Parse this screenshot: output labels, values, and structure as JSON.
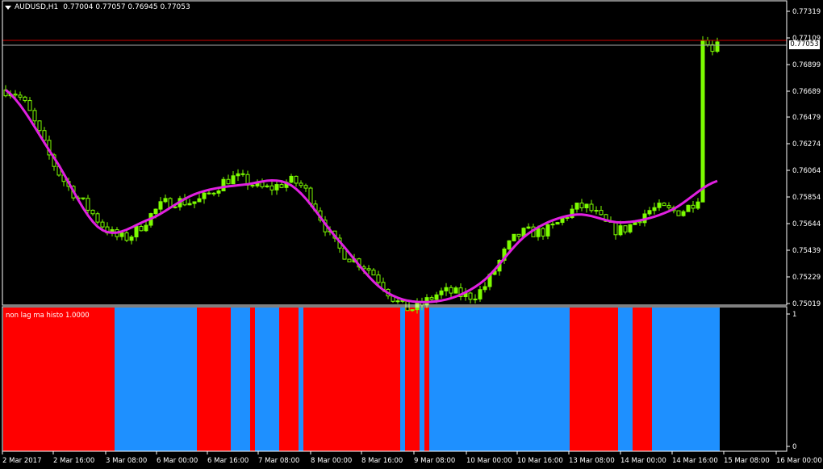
{
  "window": {
    "symbol_label": "AUDUSD,H1",
    "ohlc_label": "0.77004 0.77057 0.76945 0.77053"
  },
  "indicator": {
    "title": "non lag ma histo 1.0000",
    "axis_labels": [
      "1",
      "0"
    ]
  },
  "price_axis": {
    "ticks": [
      "0.77319",
      "0.77109",
      "0.76899",
      "0.76689",
      "0.76479",
      "0.76274",
      "0.76064",
      "0.75854",
      "0.75644",
      "0.75439",
      "0.75229",
      "0.75019"
    ],
    "current_price": "0.77053",
    "marker_price": "0.77109"
  },
  "time_axis": {
    "labels": [
      "2 Mar 2017",
      "2 Mar 16:00",
      "3 Mar 08:00",
      "6 Mar 00:00",
      "6 Mar 16:00",
      "7 Mar 08:00",
      "8 Mar 00:00",
      "8 Mar 16:00",
      "9 Mar 08:00",
      "10 Mar 00:00",
      "10 Mar 16:00",
      "13 Mar 08:00",
      "14 Mar 00:00",
      "14 Mar 16:00",
      "15 Mar 08:00",
      "16 Mar 00:00"
    ]
  },
  "colors": {
    "background": "#000000",
    "candle": "#7CFC00",
    "ma_line": "#E020E0",
    "histo_up": "#1E90FF",
    "histo_down": "#FF0000",
    "grid_frame": "#FFFFFF",
    "price_line": "#CC0000"
  },
  "chart_data": [
    {
      "type": "line",
      "series": [
        {
          "name": "",
          "x": [
            "2 Mar 2017",
            "2 Mar 16:00",
            "3 Mar 08:00",
            "6 Mar 00:00",
            "6 Mar 16:00",
            "7 Mar 08:00",
            "8 Mar 00:00",
            "8 Mar 16:00",
            "9 Mar 08:00",
            "10 Mar 00:00",
            "10 Mar 16:00",
            "13 Mar 08:00",
            "14 Mar 00:00",
            "14 Mar 16:00",
            "15 Mar 08:00",
            "16 Mar 00:00"
          ],
          "y": [
            0.7665,
            0.7614,
            0.7558,
            0.7565,
            0.7585,
            0.7592,
            0.7592,
            0.755,
            0.751,
            0.7502,
            0.7516,
            0.7554,
            0.7569,
            0.7563,
            0.7572,
            0.7595
          ]
        }
      ],
      "ylim": [
        0.75,
        0.7733
      ]
    },
    {
      "type": "bar",
      "segments": [
        {
          "state": 0,
          "bars": 23
        },
        {
          "state": 1,
          "bars": 17
        },
        {
          "state": 0,
          "bars": 7
        },
        {
          "state": 1,
          "bars": 4
        },
        {
          "state": 0,
          "bars": 1
        },
        {
          "state": 1,
          "bars": 5
        },
        {
          "state": 0,
          "bars": 4
        },
        {
          "state": 1,
          "bars": 1
        },
        {
          "state": 0,
          "bars": 20
        },
        {
          "state": 1,
          "bars": 1
        },
        {
          "state": 0,
          "bars": 3
        },
        {
          "state": 1,
          "bars": 1
        },
        {
          "state": 0,
          "bars": 1
        },
        {
          "state": 1,
          "bars": 29
        },
        {
          "state": 0,
          "bars": 10
        },
        {
          "state": 1,
          "bars": 3
        },
        {
          "state": 0,
          "bars": 4
        },
        {
          "state": 1,
          "bars": 14
        }
      ],
      "ylim": [
        0,
        1
      ]
    }
  ]
}
